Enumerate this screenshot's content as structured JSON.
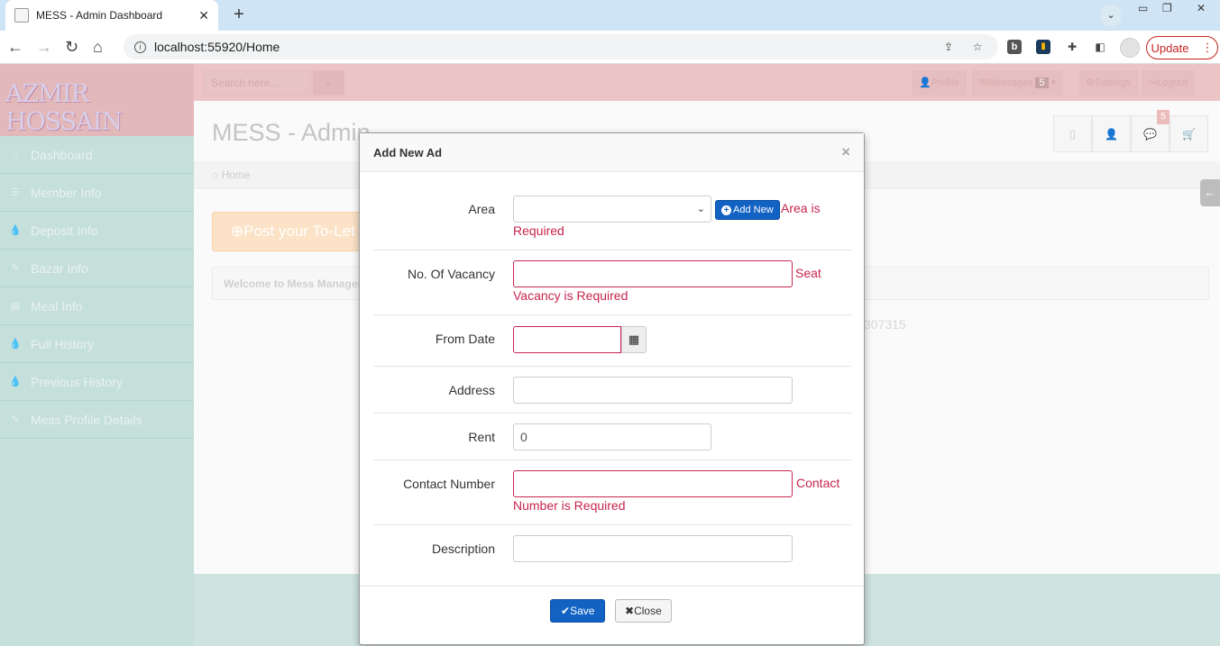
{
  "browser": {
    "tab_title": "MESS - Admin Dashboard",
    "url": "localhost:55920/Home",
    "update_label": "Update"
  },
  "app": {
    "logo_text": "AZMIR HOSSAIN",
    "search_placeholder": "Search here...",
    "top_links": {
      "profile": "Profile",
      "messages": "Messages",
      "messages_count": "5",
      "settings": "Settings",
      "logout": "Logout"
    },
    "sidebar": [
      {
        "label": "Dashboard",
        "icon": "home-icon"
      },
      {
        "label": "Member Info",
        "icon": "list-icon"
      },
      {
        "label": "Deposit Info",
        "icon": "drop-icon"
      },
      {
        "label": "Bazar Info",
        "icon": "pencil-icon"
      },
      {
        "label": "Meal Info",
        "icon": "book-icon"
      },
      {
        "label": "Full History",
        "icon": "drop-icon"
      },
      {
        "label": "Previous History",
        "icon": "drop-icon"
      },
      {
        "label": "Mess Profile Details",
        "icon": "pencil-icon"
      }
    ],
    "page_title": "MESS - Admin",
    "header_badge": "5",
    "breadcrumb": "Home",
    "post_button": "Post your To-Let",
    "welcome_text": "Welcome to Mess Manager",
    "number_text": "307315"
  },
  "modal": {
    "title": "Add New Ad",
    "fields": {
      "area": {
        "label": "Area",
        "value": "",
        "add_new": "Add New",
        "error": "Area is Required"
      },
      "vacancy": {
        "label": "No. Of Vacancy",
        "value": "",
        "error": "Seat Vacancy is Required"
      },
      "from_date": {
        "label": "From Date",
        "value": ""
      },
      "address": {
        "label": "Address",
        "value": ""
      },
      "rent": {
        "label": "Rent",
        "value": "0"
      },
      "contact": {
        "label": "Contact Number",
        "value": "",
        "error": "Contact Number is Required"
      },
      "description": {
        "label": "Description",
        "value": ""
      }
    },
    "save_label": "Save",
    "close_label": "Close"
  },
  "colors": {
    "accent": "#1262c4",
    "error": "#c7254e"
  }
}
